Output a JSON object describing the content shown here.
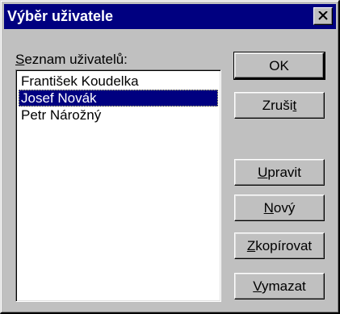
{
  "window": {
    "title": "Výběr uživatele",
    "close_label": "Close"
  },
  "list": {
    "label_accel": "S",
    "label_rest": "eznam uživatelů:",
    "items": [
      {
        "label": "František Koudelka",
        "selected": false
      },
      {
        "label": "Josef Novák",
        "selected": true
      },
      {
        "label": "Petr Nárožný",
        "selected": false
      }
    ]
  },
  "buttons": {
    "ok": {
      "label": "OK"
    },
    "cancel": {
      "pre": "Zruši",
      "accel": "t",
      "post": ""
    },
    "edit": {
      "pre": "",
      "accel": "U",
      "post": "pravit"
    },
    "new": {
      "pre": "",
      "accel": "N",
      "post": "ový"
    },
    "copy": {
      "pre": "",
      "accel": "Z",
      "post": "kopírovat"
    },
    "delete": {
      "pre": "",
      "accel": "V",
      "post": "ymazat"
    }
  },
  "colors": {
    "titlebar": "#000080",
    "dialog_face": "#c0c0c0",
    "selection": "#000080"
  },
  "icons": {
    "close": "close-icon"
  }
}
